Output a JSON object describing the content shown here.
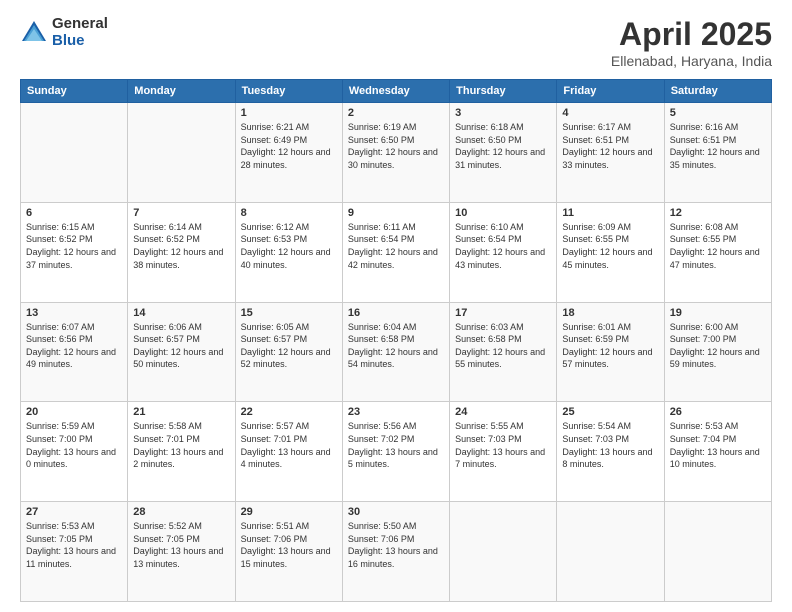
{
  "logo": {
    "general": "General",
    "blue": "Blue"
  },
  "header": {
    "month_year": "April 2025",
    "location": "Ellenabad, Haryana, India"
  },
  "weekdays": [
    "Sunday",
    "Monday",
    "Tuesday",
    "Wednesday",
    "Thursday",
    "Friday",
    "Saturday"
  ],
  "weeks": [
    [
      {
        "num": "",
        "sunrise": "",
        "sunset": "",
        "daylight": ""
      },
      {
        "num": "",
        "sunrise": "",
        "sunset": "",
        "daylight": ""
      },
      {
        "num": "1",
        "sunrise": "Sunrise: 6:21 AM",
        "sunset": "Sunset: 6:49 PM",
        "daylight": "Daylight: 12 hours and 28 minutes."
      },
      {
        "num": "2",
        "sunrise": "Sunrise: 6:19 AM",
        "sunset": "Sunset: 6:50 PM",
        "daylight": "Daylight: 12 hours and 30 minutes."
      },
      {
        "num": "3",
        "sunrise": "Sunrise: 6:18 AM",
        "sunset": "Sunset: 6:50 PM",
        "daylight": "Daylight: 12 hours and 31 minutes."
      },
      {
        "num": "4",
        "sunrise": "Sunrise: 6:17 AM",
        "sunset": "Sunset: 6:51 PM",
        "daylight": "Daylight: 12 hours and 33 minutes."
      },
      {
        "num": "5",
        "sunrise": "Sunrise: 6:16 AM",
        "sunset": "Sunset: 6:51 PM",
        "daylight": "Daylight: 12 hours and 35 minutes."
      }
    ],
    [
      {
        "num": "6",
        "sunrise": "Sunrise: 6:15 AM",
        "sunset": "Sunset: 6:52 PM",
        "daylight": "Daylight: 12 hours and 37 minutes."
      },
      {
        "num": "7",
        "sunrise": "Sunrise: 6:14 AM",
        "sunset": "Sunset: 6:52 PM",
        "daylight": "Daylight: 12 hours and 38 minutes."
      },
      {
        "num": "8",
        "sunrise": "Sunrise: 6:12 AM",
        "sunset": "Sunset: 6:53 PM",
        "daylight": "Daylight: 12 hours and 40 minutes."
      },
      {
        "num": "9",
        "sunrise": "Sunrise: 6:11 AM",
        "sunset": "Sunset: 6:54 PM",
        "daylight": "Daylight: 12 hours and 42 minutes."
      },
      {
        "num": "10",
        "sunrise": "Sunrise: 6:10 AM",
        "sunset": "Sunset: 6:54 PM",
        "daylight": "Daylight: 12 hours and 43 minutes."
      },
      {
        "num": "11",
        "sunrise": "Sunrise: 6:09 AM",
        "sunset": "Sunset: 6:55 PM",
        "daylight": "Daylight: 12 hours and 45 minutes."
      },
      {
        "num": "12",
        "sunrise": "Sunrise: 6:08 AM",
        "sunset": "Sunset: 6:55 PM",
        "daylight": "Daylight: 12 hours and 47 minutes."
      }
    ],
    [
      {
        "num": "13",
        "sunrise": "Sunrise: 6:07 AM",
        "sunset": "Sunset: 6:56 PM",
        "daylight": "Daylight: 12 hours and 49 minutes."
      },
      {
        "num": "14",
        "sunrise": "Sunrise: 6:06 AM",
        "sunset": "Sunset: 6:57 PM",
        "daylight": "Daylight: 12 hours and 50 minutes."
      },
      {
        "num": "15",
        "sunrise": "Sunrise: 6:05 AM",
        "sunset": "Sunset: 6:57 PM",
        "daylight": "Daylight: 12 hours and 52 minutes."
      },
      {
        "num": "16",
        "sunrise": "Sunrise: 6:04 AM",
        "sunset": "Sunset: 6:58 PM",
        "daylight": "Daylight: 12 hours and 54 minutes."
      },
      {
        "num": "17",
        "sunrise": "Sunrise: 6:03 AM",
        "sunset": "Sunset: 6:58 PM",
        "daylight": "Daylight: 12 hours and 55 minutes."
      },
      {
        "num": "18",
        "sunrise": "Sunrise: 6:01 AM",
        "sunset": "Sunset: 6:59 PM",
        "daylight": "Daylight: 12 hours and 57 minutes."
      },
      {
        "num": "19",
        "sunrise": "Sunrise: 6:00 AM",
        "sunset": "Sunset: 7:00 PM",
        "daylight": "Daylight: 12 hours and 59 minutes."
      }
    ],
    [
      {
        "num": "20",
        "sunrise": "Sunrise: 5:59 AM",
        "sunset": "Sunset: 7:00 PM",
        "daylight": "Daylight: 13 hours and 0 minutes."
      },
      {
        "num": "21",
        "sunrise": "Sunrise: 5:58 AM",
        "sunset": "Sunset: 7:01 PM",
        "daylight": "Daylight: 13 hours and 2 minutes."
      },
      {
        "num": "22",
        "sunrise": "Sunrise: 5:57 AM",
        "sunset": "Sunset: 7:01 PM",
        "daylight": "Daylight: 13 hours and 4 minutes."
      },
      {
        "num": "23",
        "sunrise": "Sunrise: 5:56 AM",
        "sunset": "Sunset: 7:02 PM",
        "daylight": "Daylight: 13 hours and 5 minutes."
      },
      {
        "num": "24",
        "sunrise": "Sunrise: 5:55 AM",
        "sunset": "Sunset: 7:03 PM",
        "daylight": "Daylight: 13 hours and 7 minutes."
      },
      {
        "num": "25",
        "sunrise": "Sunrise: 5:54 AM",
        "sunset": "Sunset: 7:03 PM",
        "daylight": "Daylight: 13 hours and 8 minutes."
      },
      {
        "num": "26",
        "sunrise": "Sunrise: 5:53 AM",
        "sunset": "Sunset: 7:04 PM",
        "daylight": "Daylight: 13 hours and 10 minutes."
      }
    ],
    [
      {
        "num": "27",
        "sunrise": "Sunrise: 5:53 AM",
        "sunset": "Sunset: 7:05 PM",
        "daylight": "Daylight: 13 hours and 11 minutes."
      },
      {
        "num": "28",
        "sunrise": "Sunrise: 5:52 AM",
        "sunset": "Sunset: 7:05 PM",
        "daylight": "Daylight: 13 hours and 13 minutes."
      },
      {
        "num": "29",
        "sunrise": "Sunrise: 5:51 AM",
        "sunset": "Sunset: 7:06 PM",
        "daylight": "Daylight: 13 hours and 15 minutes."
      },
      {
        "num": "30",
        "sunrise": "Sunrise: 5:50 AM",
        "sunset": "Sunset: 7:06 PM",
        "daylight": "Daylight: 13 hours and 16 minutes."
      },
      {
        "num": "",
        "sunrise": "",
        "sunset": "",
        "daylight": ""
      },
      {
        "num": "",
        "sunrise": "",
        "sunset": "",
        "daylight": ""
      },
      {
        "num": "",
        "sunrise": "",
        "sunset": "",
        "daylight": ""
      }
    ]
  ]
}
